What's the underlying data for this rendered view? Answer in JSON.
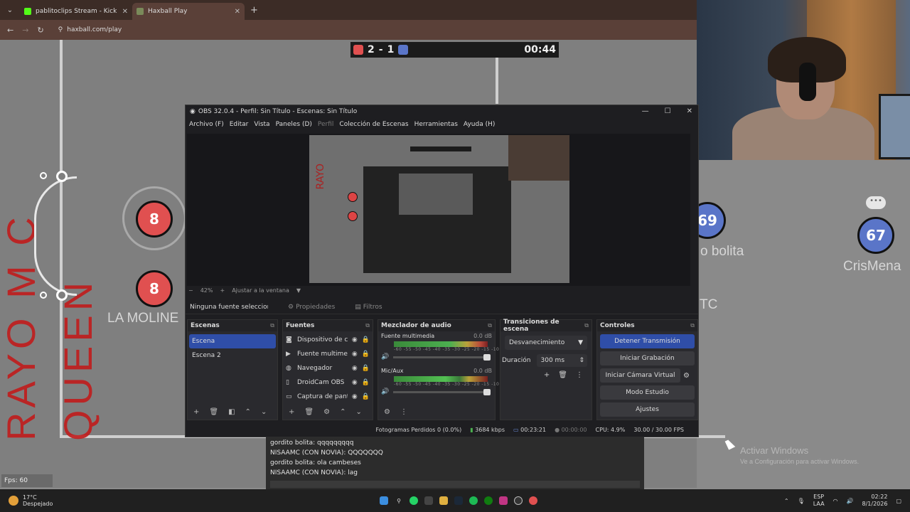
{
  "browser": {
    "tabs": [
      {
        "title": "pablitoclips Stream - Kick Dashb",
        "favicon_color": "#53fc18"
      },
      {
        "title": "Haxball Play",
        "favicon_color": "#7a8a5a"
      }
    ],
    "url": "haxball.com/play"
  },
  "game": {
    "score_red": "2",
    "score_sep": "-",
    "score_blue": "1",
    "time": "00:44",
    "banner_text": "RAYO M C QUEEN",
    "players": [
      {
        "number": "8",
        "color": "red"
      },
      {
        "number": "8",
        "color": "red",
        "name": "LA MOLINE"
      },
      {
        "number": "69",
        "color": "blue",
        "name": "o bolita"
      },
      {
        "number": "67",
        "color": "blue",
        "name": "CrisMena"
      }
    ],
    "partial_text": "TC"
  },
  "obs": {
    "title": "OBS 32.0.4 - Perfil: Sin Título - Escenas: Sin Título",
    "menu": [
      "Archivo (F)",
      "Editar",
      "Vista",
      "Paneles (D)",
      "Perfil",
      "Colección de Escenas",
      "Herramientas",
      "Ayuda (H)"
    ],
    "zoom": "42%",
    "fit_label": "Ajustar a la ventana",
    "no_source": "Ninguna fuente seleccionad",
    "properties_label": "Propiedades",
    "filters_label": "Filtros",
    "scenes": {
      "header": "Escenas",
      "items": [
        "Escena",
        "Escena 2"
      ]
    },
    "sources": {
      "header": "Fuentes",
      "items": [
        "Dispositivo de cap",
        "Fuente multimedi",
        "Navegador",
        "DroidCam OBS",
        "Captura de panta"
      ]
    },
    "mixer": {
      "header": "Mezclador de audio",
      "channels": [
        {
          "name": "Fuente multimedia",
          "db": "0.0 dB"
        },
        {
          "name": "Mic/Aux",
          "db": "0.0 dB"
        }
      ],
      "scale": "-60 -55 -50 -45 -40 -35 -30 -25 -20 -15 -10 -5 0"
    },
    "transitions": {
      "header": "Transiciones de escena",
      "selected": "Desvanecimiento",
      "duration_label": "Duración",
      "duration_value": "300 ms"
    },
    "controls": {
      "header": "Controles",
      "stop_stream": "Detener Transmisión",
      "start_recording": "Iniciar Grabación",
      "virtual_cam": "Iniciar Cámara Virtual",
      "studio_mode": "Modo Estudio",
      "settings": "Ajustes"
    },
    "status": {
      "dropped": "Fotogramas Perdidos 0 (0.0%)",
      "bitrate": "3684 kbps",
      "stream_time": "00:23:21",
      "rec_time": "00:00:00",
      "cpu": "CPU: 4.9%",
      "fps": "30.00 / 30.00 FPS"
    }
  },
  "chat": {
    "lines": [
      "gordito bolita: qqqqqqqqq",
      "NISAAMC (CON NOVIA): QQQQQQQ",
      "gordito bolita: ola cambeses",
      "NISAAMC (CON NOVIA): lag"
    ]
  },
  "fps_counter": "Fps: 60",
  "windows_activation": {
    "title": "Activar Windows",
    "subtitle": "Ve a Configuración para activar Windows."
  },
  "taskbar": {
    "weather_temp": "17°C",
    "weather_desc": "Despejado",
    "lang_top": "ESP",
    "lang_bottom": "LAA",
    "time": "02:22",
    "date": "8/1/2026"
  }
}
